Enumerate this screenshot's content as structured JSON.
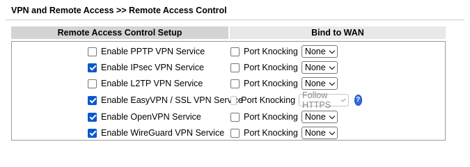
{
  "breadcrumb": "VPN and Remote Access >> Remote Access Control",
  "headers": {
    "left": "Remote Access Control Setup",
    "right": "Bind to WAN"
  },
  "rows": [
    {
      "service": "Enable PPTP VPN Service",
      "enabled": false,
      "port_knocking": "Port Knocking",
      "pk_checked": false,
      "select": "None",
      "select_disabled": false
    },
    {
      "service": "Enable IPsec VPN Service",
      "enabled": true,
      "port_knocking": "Port Knocking",
      "pk_checked": false,
      "select": "None",
      "select_disabled": false
    },
    {
      "service": "Enable L2TP VPN Service",
      "enabled": false,
      "port_knocking": "Port Knocking",
      "pk_checked": false,
      "select": "None",
      "select_disabled": false
    },
    {
      "service": "Enable EasyVPN / SSL VPN Service",
      "enabled": true,
      "port_knocking": "Port Knocking",
      "pk_checked": false,
      "select": "Follow HTTPS",
      "select_disabled": true
    },
    {
      "service": "Enable OpenVPN Service",
      "enabled": true,
      "port_knocking": "Port Knocking",
      "pk_checked": false,
      "select": "None",
      "select_disabled": false
    },
    {
      "service": "Enable WireGuard VPN Service",
      "enabled": true,
      "port_knocking": "Port Knocking",
      "pk_checked": false,
      "select": "None",
      "select_disabled": false
    }
  ],
  "help_icon": "help-icon",
  "help_glyph": "?",
  "colors": {
    "checkbox_checked": "#0b57d0",
    "help_icon": "#2f6ee3"
  }
}
